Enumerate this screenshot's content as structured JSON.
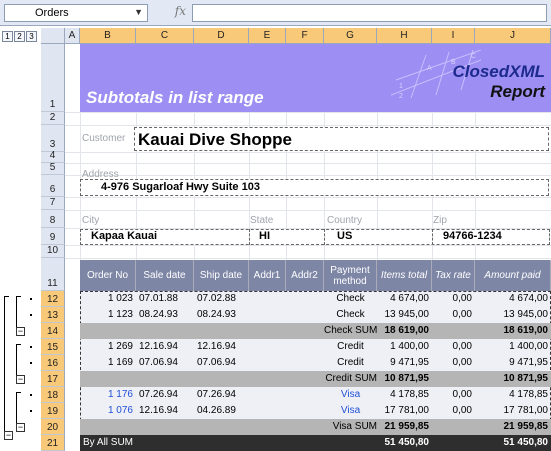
{
  "formula_bar": {
    "name_box": "Orders",
    "fx": "fx",
    "formula": ""
  },
  "outline_levels": [
    "1",
    "2",
    "3"
  ],
  "columns": [
    "A",
    "B",
    "C",
    "D",
    "E",
    "F",
    "G",
    "H",
    "I",
    "J"
  ],
  "rows": [
    "1",
    "2",
    "3",
    "4",
    "5",
    "6",
    "7",
    "8",
    "9",
    "10",
    "11",
    "12",
    "13",
    "14",
    "15",
    "16",
    "17",
    "18",
    "19",
    "20",
    "21"
  ],
  "banner": {
    "title": "Subtotals in list range",
    "logo_line1": "ClosedXML",
    "logo_line2": "Report",
    "deco_letters": [
      "A",
      "B",
      "C",
      "1",
      "2"
    ]
  },
  "customer": {
    "label": "Customer",
    "value": "Kauai Dive Shoppe"
  },
  "address": {
    "label": "Address",
    "value": "4-976 Sugarloaf Hwy Suite 103"
  },
  "city": {
    "label": "City",
    "value": "Kapaa Kauai"
  },
  "state": {
    "label": "State",
    "value": "HI"
  },
  "country": {
    "label": "Country",
    "value": "US"
  },
  "zip": {
    "label": "Zip",
    "value": "94766-1234"
  },
  "table": {
    "headers": [
      "Order No",
      "Sale date",
      "Ship date",
      "Addr1",
      "Addr2",
      "Payment method",
      "Items total",
      "Tax rate",
      "Amount paid"
    ],
    "rows": [
      {
        "order": "1 023",
        "sale": "07.01.88",
        "ship": "07.02.88",
        "method": "Check",
        "items": "4 674,00",
        "tax": "0,00",
        "paid": "4 674,00"
      },
      {
        "order": "1 123",
        "sale": "08.24.93",
        "ship": "08.24.93",
        "method": "Check",
        "items": "13 945,00",
        "tax": "0,00",
        "paid": "13 945,00"
      },
      {
        "sum_label": "Check SUM",
        "items": "18 619,00",
        "paid": "18 619,00"
      },
      {
        "order": "1 269",
        "sale": "12.16.94",
        "ship": "12.16.94",
        "method": "Credit",
        "items": "1 400,00",
        "tax": "0,00",
        "paid": "1 400,00"
      },
      {
        "order": "1 169",
        "sale": "07.06.94",
        "ship": "07.06.94",
        "method": "Credit",
        "items": "9 471,95",
        "tax": "0,00",
        "paid": "9 471,95"
      },
      {
        "sum_label": "Credit SUM",
        "items": "10 871,95",
        "paid": "10 871,95"
      },
      {
        "order": "1 176",
        "sale": "07.26.94",
        "ship": "07.26.94",
        "method": "Visa",
        "items": "4 178,85",
        "tax": "0,00",
        "paid": "4 178,85"
      },
      {
        "order": "1 076",
        "sale": "12.16.94",
        "ship": "04.26.89",
        "method": "Visa",
        "items": "17 781,00",
        "tax": "0,00",
        "paid": "17 781,00"
      },
      {
        "sum_label": "Visa SUM",
        "items": "21 959,85",
        "paid": "21 959,85"
      },
      {
        "sum_label": "By All SUM",
        "items": "51 450,80",
        "paid": "51 450,80"
      }
    ]
  },
  "colors": {
    "banner": "#9c8ef2",
    "table_header": "#7e86a6",
    "subtotal_row": "#b5b5b5",
    "grand_total_row": "#2e2e2e",
    "selected_header": "#f9c97a",
    "link": "#1f4fd6"
  }
}
